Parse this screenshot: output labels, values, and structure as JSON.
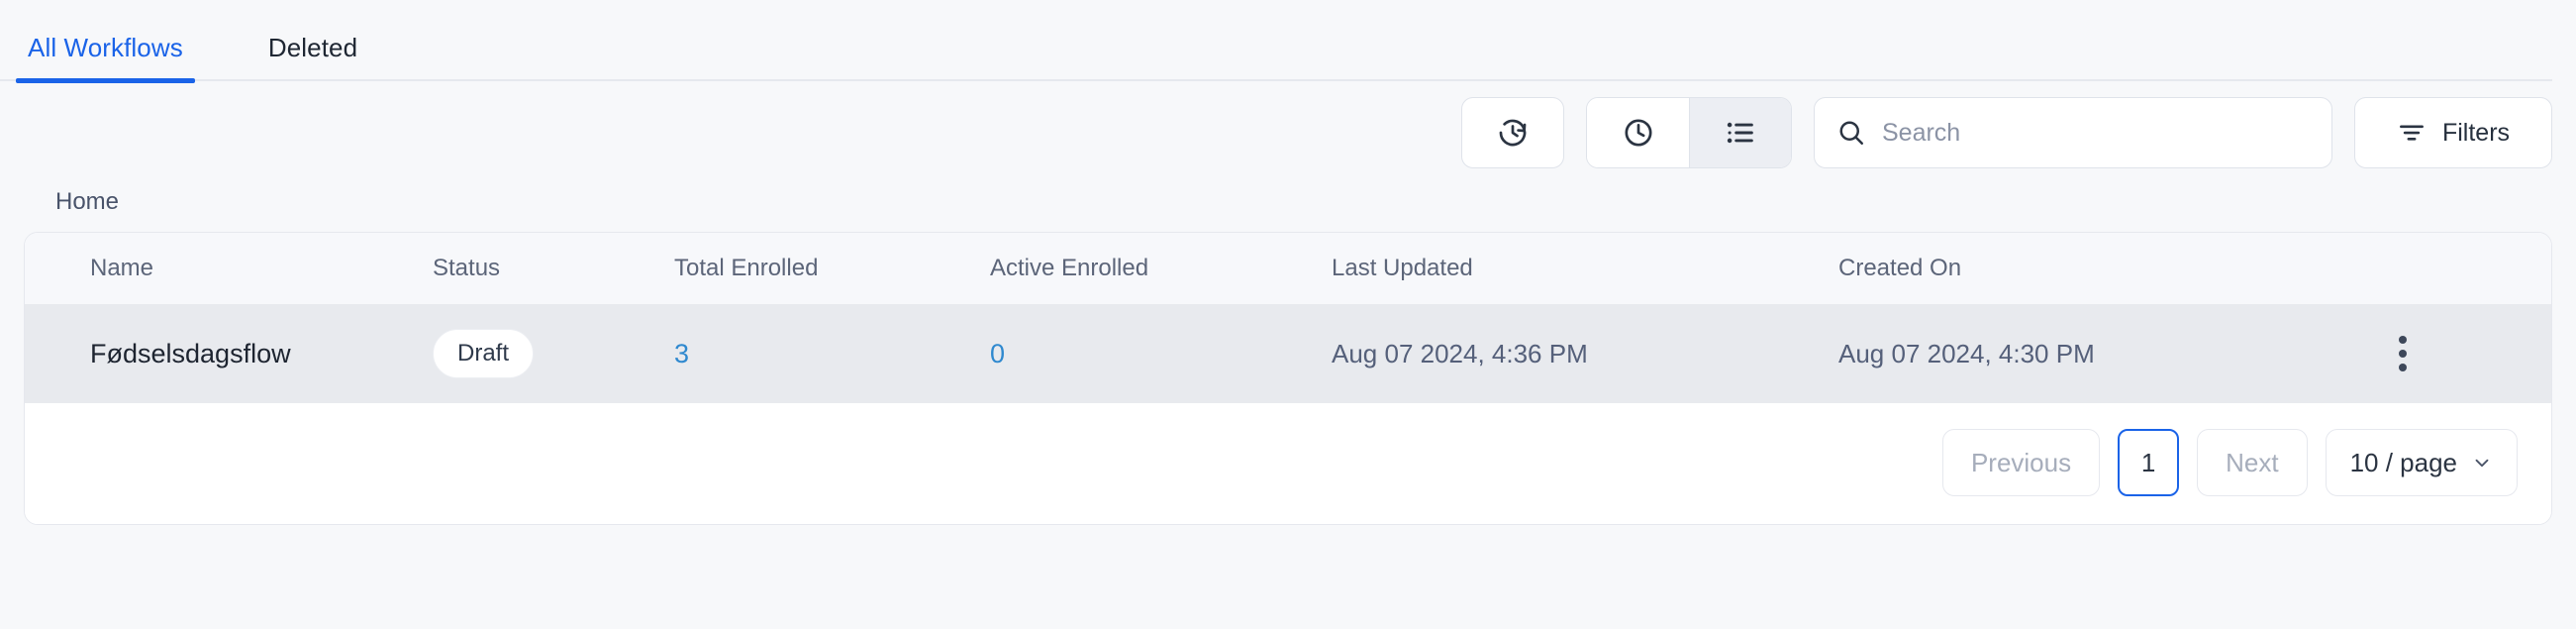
{
  "tabs": [
    {
      "label": "All Workflows",
      "active": true
    },
    {
      "label": "Deleted",
      "active": false
    }
  ],
  "toolbar": {
    "history_button_icon": "clock-refresh-icon",
    "view_clock_icon": "clock-icon",
    "view_list_icon": "list-icon",
    "search": {
      "value": "",
      "placeholder": "Search",
      "icon": "search-icon"
    },
    "filters": {
      "label": "Filters",
      "icon": "filter-icon"
    }
  },
  "breadcrumb": {
    "label": "Home"
  },
  "table": {
    "columns": [
      "Name",
      "Status",
      "Total Enrolled",
      "Active Enrolled",
      "Last Updated",
      "Created On"
    ],
    "rows": [
      {
        "name": "Fødselsdagsflow",
        "status": "Draft",
        "total_enrolled": "3",
        "active_enrolled": "0",
        "last_updated": "Aug 07 2024, 4:36 PM",
        "created_on": "Aug 07 2024, 4:30 PM",
        "menu_icon": "kebab-menu-icon"
      }
    ]
  },
  "pagination": {
    "previous_label": "Previous",
    "current_page": "1",
    "next_label": "Next",
    "page_size_label": "10 / page",
    "chevron_icon": "chevron-down-icon"
  },
  "colors": {
    "accent": "#1a63e8",
    "link": "#2f89cf",
    "page_bg": "#f7f8fa",
    "row_bg": "#e8eaee"
  }
}
